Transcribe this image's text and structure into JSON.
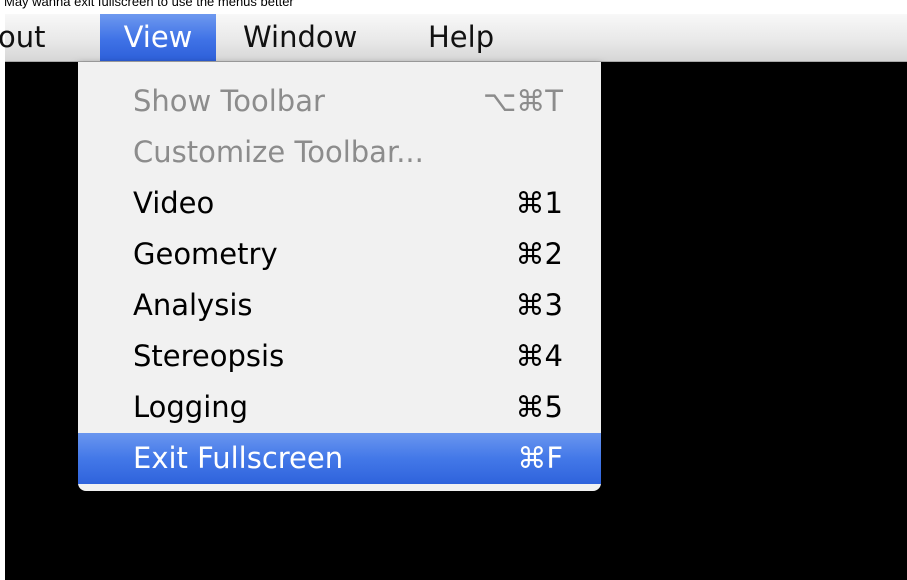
{
  "caption": "May wanna exit fullscreen to use the menus better",
  "menubar": {
    "partial_item": "out",
    "items": [
      {
        "label": "View"
      },
      {
        "label": "Window"
      },
      {
        "label": "Help"
      }
    ]
  },
  "view_menu": {
    "items": [
      {
        "label": "Show Toolbar",
        "shortcut": "⌥⌘T",
        "enabled": false
      },
      {
        "label": "Customize Toolbar...",
        "shortcut": "",
        "enabled": false
      },
      {
        "label": "Video",
        "shortcut": "⌘1",
        "enabled": true
      },
      {
        "label": "Geometry",
        "shortcut": "⌘2",
        "enabled": true
      },
      {
        "label": "Analysis",
        "shortcut": "⌘3",
        "enabled": true
      },
      {
        "label": "Stereopsis",
        "shortcut": "⌘4",
        "enabled": true
      },
      {
        "label": "Logging",
        "shortcut": "⌘5",
        "enabled": true
      },
      {
        "label": "Exit Fullscreen",
        "shortcut": "⌘F",
        "enabled": true,
        "selected": true
      }
    ]
  },
  "colors": {
    "highlight": "#3f72e6",
    "menu_bg": "#f1f1f1",
    "disabled_text": "#8c8c8c",
    "background": "#000000"
  }
}
